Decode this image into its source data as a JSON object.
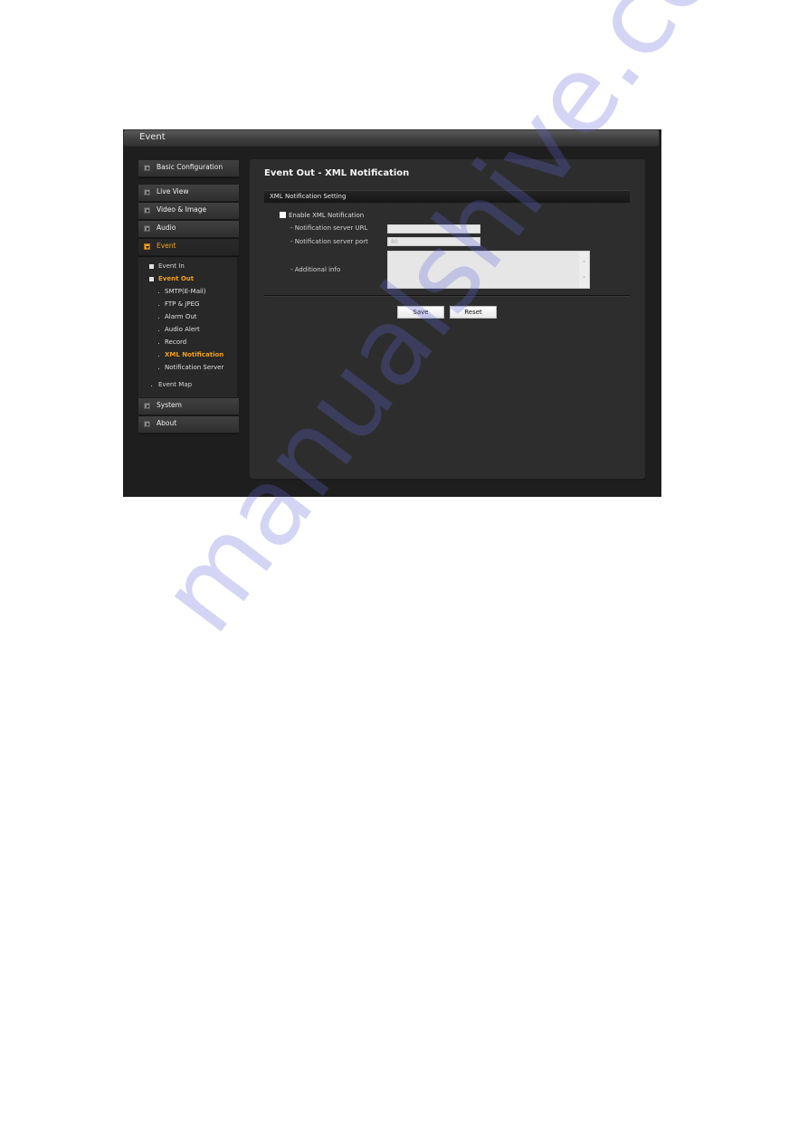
{
  "window": {
    "title": "Event"
  },
  "sidebar": {
    "top_items": [
      {
        "label": "Basic Configuration",
        "icon": "arrow-right-icon"
      },
      {
        "label": "Live View",
        "icon": "arrow-right-icon"
      },
      {
        "label": "Video & Image",
        "icon": "arrow-right-icon"
      },
      {
        "label": "Audio",
        "icon": "arrow-right-icon"
      },
      {
        "label": "Event",
        "icon": "arrow-down-icon",
        "active": true
      }
    ],
    "event_submenu": {
      "event_in": "Event In",
      "event_out": "Event Out",
      "event_out_items": [
        "SMTP(E-Mail)",
        "FTP & JPEG",
        "Alarm Out",
        "Audio Alert",
        "Record",
        "XML Notification",
        "Notification Server"
      ],
      "selected": "XML Notification",
      "event_map": "Event Map"
    },
    "bottom_items": [
      {
        "label": "System",
        "icon": "arrow-right-icon"
      },
      {
        "label": "About",
        "icon": "arrow-right-icon"
      }
    ]
  },
  "main": {
    "title": "Event Out - XML Notification",
    "section_title": "XML Notification Setting",
    "enable_label": "Enable XML Notification",
    "enable_checked": false,
    "fields": {
      "url_label": "- Notification server URL",
      "url_value": "",
      "port_label": "- Notification server port",
      "port_value": "80",
      "info_label": "- Additional info",
      "info_value": ""
    },
    "buttons": {
      "save": "Save",
      "reset": "Reset"
    }
  },
  "colors": {
    "accent": "#f0a020",
    "background": "#1e1e1e",
    "panel": "#2d2d2d"
  },
  "watermark": "manualshive.com"
}
